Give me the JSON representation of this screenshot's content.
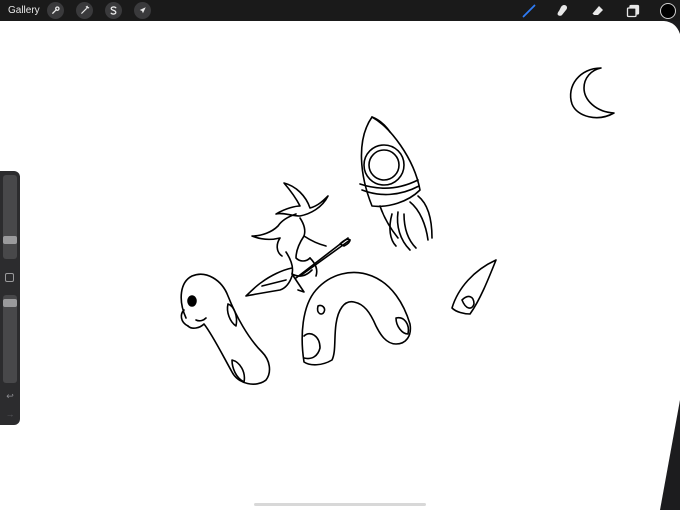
{
  "topbar": {
    "gallery_label": "Gallery",
    "left_tools": [
      {
        "name": "actions",
        "icon": "wrench-icon"
      },
      {
        "name": "adjustments",
        "icon": "magic-wand-icon"
      },
      {
        "name": "selection",
        "icon": "selection-s-icon"
      },
      {
        "name": "transform",
        "icon": "arrow-cursor-icon"
      }
    ],
    "right_tools": [
      {
        "name": "brush",
        "icon": "brush-icon",
        "active": true
      },
      {
        "name": "smudge",
        "icon": "smudge-icon",
        "active": false
      },
      {
        "name": "eraser",
        "icon": "eraser-icon",
        "active": false
      },
      {
        "name": "layers",
        "icon": "layers-icon",
        "active": false
      }
    ],
    "current_color": "#000000"
  },
  "sidebar": {
    "brush_size_level": 0.7,
    "opacity_level": 0.95,
    "undo_icon": "undo-icon",
    "redo_icon": "redo-icon",
    "modify_icon": "square-icon"
  },
  "colors": {
    "accent_active_tool": "#2f7cf6",
    "toolbar_bg": "#1a1a1a",
    "canvas_bg": "#ffffff",
    "ink": "#000000"
  },
  "canvas": {
    "drawings": [
      "crescent-moon",
      "rocket",
      "witch-on-broom",
      "sea-serpent-head",
      "sea-serpent-hump",
      "sea-serpent-tail-fin"
    ]
  }
}
